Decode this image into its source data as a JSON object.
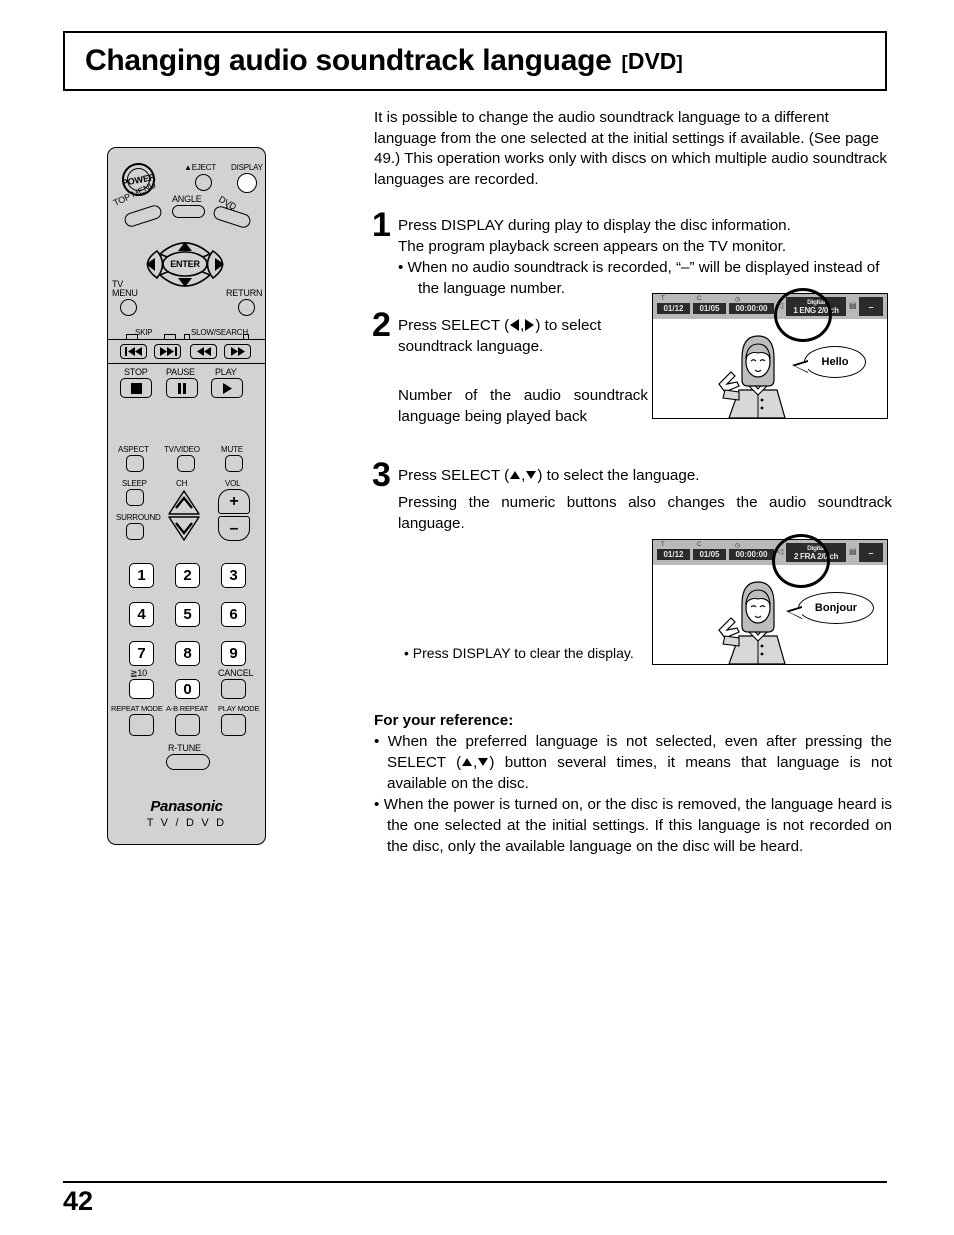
{
  "title": {
    "main": "Changing audio soundtrack language",
    "tag_open": "[",
    "tag_text": "DVD",
    "tag_close": "]"
  },
  "intro": "It is possible to change the audio soundtrack language to a different language from the one selected at the initial settings if available. (See page 49.) This operation works only with discs on which multiple audio soundtrack languages are recorded.",
  "steps": {
    "one": {
      "number": "1",
      "line1": "Press DISPLAY during play to display the disc information.",
      "line2": "The program playback screen appears on the TV monitor.",
      "bullet1a": "• When no audio soundtrack is recorded, “–” will be displayed instead of",
      "bullet1b": "the language number."
    },
    "two": {
      "number": "2",
      "lead": "Press SELECT (",
      "mid": ",",
      "tail": ") to select",
      "line2": "soundtrack language.",
      "note": "Number of the audio soundtrack language being played back"
    },
    "three": {
      "number": "3",
      "lead": "Press SELECT (",
      "mid": ",",
      "tail": ") to select the language.",
      "sub": "Pressing the numeric buttons also changes the audio soundtrack language.",
      "clear_note": "• Press DISPLAY to clear the display."
    }
  },
  "reference": {
    "title": "For your reference:",
    "items": [
      "When the preferred language is not selected, even after pressing the SELECT ( ▲ , ▼ ) button several times, it means that language is not available on the disc.",
      "When the power is turned on, or the disc is removed, the language heard is the one selected at the initial settings. If this language is not recorded on the disc, only the available language on the disc will be heard."
    ],
    "item1_pre": "When the preferred language is not selected, even after pressing the",
    "item1_sel": "SELECT (",
    "item1_post": ") button several times, it means that language is not available on the disc."
  },
  "remote": {
    "power": "POWER",
    "eject": "EJECT",
    "eject_icon": "eject-triangle",
    "display": "DISPLAY",
    "angle": "ANGLE",
    "top_menu": "TOP MENU",
    "dvd_menu": "DVD MENU",
    "dvd_menu_l1": "DVD",
    "dvd_menu_l2": "MENU",
    "tv_menu_l1": "TV",
    "tv_menu_l2": "MENU",
    "enter": "ENTER",
    "return": "RETURN",
    "skip": "SKIP",
    "slow_search": "SLOW/SEARCH",
    "stop": "STOP",
    "pause": "PAUSE",
    "play": "PLAY",
    "aspect": "ASPECT",
    "tv_video": "TV/VIDEO",
    "mute": "MUTE",
    "sleep": "SLEEP",
    "ch": "CH",
    "vol": "VOL",
    "vol_plus": "+",
    "vol_minus": "–",
    "surround": "SURROUND",
    "numbers": [
      "1",
      "2",
      "3",
      "4",
      "5",
      "6",
      "7",
      "8",
      "9"
    ],
    "zero": "0",
    "ten_plus": "≧10",
    "cancel": "CANCEL",
    "repeat_mode": "REPEAT MODE",
    "ab_repeat": "A-B REPEAT",
    "play_mode": "PLAY MODE",
    "r_tune": "R-TUNE",
    "brand": "Panasonic",
    "brand_sub": "T V / D V D"
  },
  "tv_screens": [
    {
      "title_no": "01/12",
      "chapter_no": "01/05",
      "time": "00:00:00",
      "audio_label": "Digital",
      "audio_value": "1 ENG 2/0 ch",
      "subtitle_value": "–",
      "bubble_text": "Hello"
    },
    {
      "title_no": "01/12",
      "chapter_no": "01/05",
      "time": "00:00:00",
      "audio_label": "Digital",
      "audio_value": "2 FRA 2/0 ch",
      "subtitle_value": "–",
      "bubble_text": "Bonjour"
    }
  ],
  "footer": {
    "page_number": "42"
  },
  "colors": {
    "remote_body": "#d2d2d2",
    "osd_bar": "#b9b9b9",
    "osd_cell": "#2b2b2b",
    "text": "#000000"
  }
}
